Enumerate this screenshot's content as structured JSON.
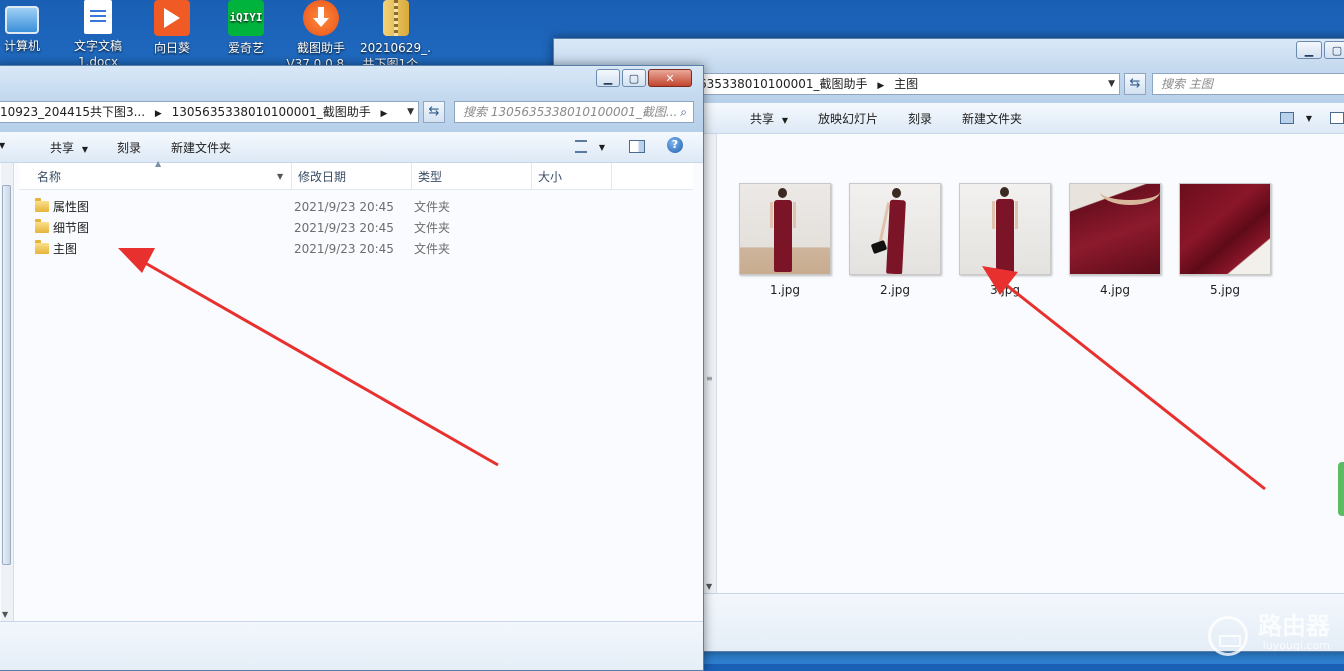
{
  "desktop": {
    "icons": [
      {
        "label": "计算机",
        "icon": "computer-icon"
      },
      {
        "label": "文字文稿",
        "label2": "1.docx",
        "icon": "word-document-icon"
      },
      {
        "label": "向日葵",
        "icon": "sunflower-app-icon"
      },
      {
        "label": "爱奇艺",
        "icon": "iqiyi-app-icon"
      },
      {
        "label": "截图助手",
        "label2": "V37.0.0.8...",
        "icon": "download-helper-icon"
      },
      {
        "label": "20210629_...",
        "label2": "共下图1个...",
        "icon": "zip-folder-icon"
      }
    ]
  },
  "left_window": {
    "breadcrumb_part1": "10923_204415共下图3...",
    "breadcrumb_part2": "1305635338010100001_截图助手",
    "search_placeholder": "搜索 1305635338010100001_截图...",
    "toolbar": {
      "share": "共享",
      "burn": "刻录",
      "new_folder": "新建文件夹"
    },
    "columns": {
      "name": "名称",
      "date": "修改日期",
      "type": "类型",
      "size": "大小"
    },
    "rows": [
      {
        "name": "属性图",
        "date": "2021/9/23 20:45",
        "type": "文件夹"
      },
      {
        "name": "细节图",
        "date": "2021/9/23 20:45",
        "type": "文件夹"
      },
      {
        "name": "主图",
        "date": "2021/9/23 20:45",
        "type": "文件夹"
      }
    ]
  },
  "right_window": {
    "breadcrumb_part1": "635338010100001_截图助手",
    "breadcrumb_part2": "主图",
    "search_placeholder": "搜索 主图",
    "toolbar": {
      "share": "共享",
      "slideshow": "放映幻灯片",
      "burn": "刻录",
      "new_folder": "新建文件夹"
    },
    "thumbnails": [
      {
        "name": "1.jpg"
      },
      {
        "name": "2.jpg"
      },
      {
        "name": "3.jpg"
      },
      {
        "name": "4.jpg"
      },
      {
        "name": "5.jpg"
      }
    ]
  },
  "watermark": {
    "title": "路由器",
    "url": "luyouqi.com"
  },
  "colors": {
    "arrow": "#e8312e",
    "desktop_blue": "#2a7fd6",
    "dress": "#7a1426"
  }
}
